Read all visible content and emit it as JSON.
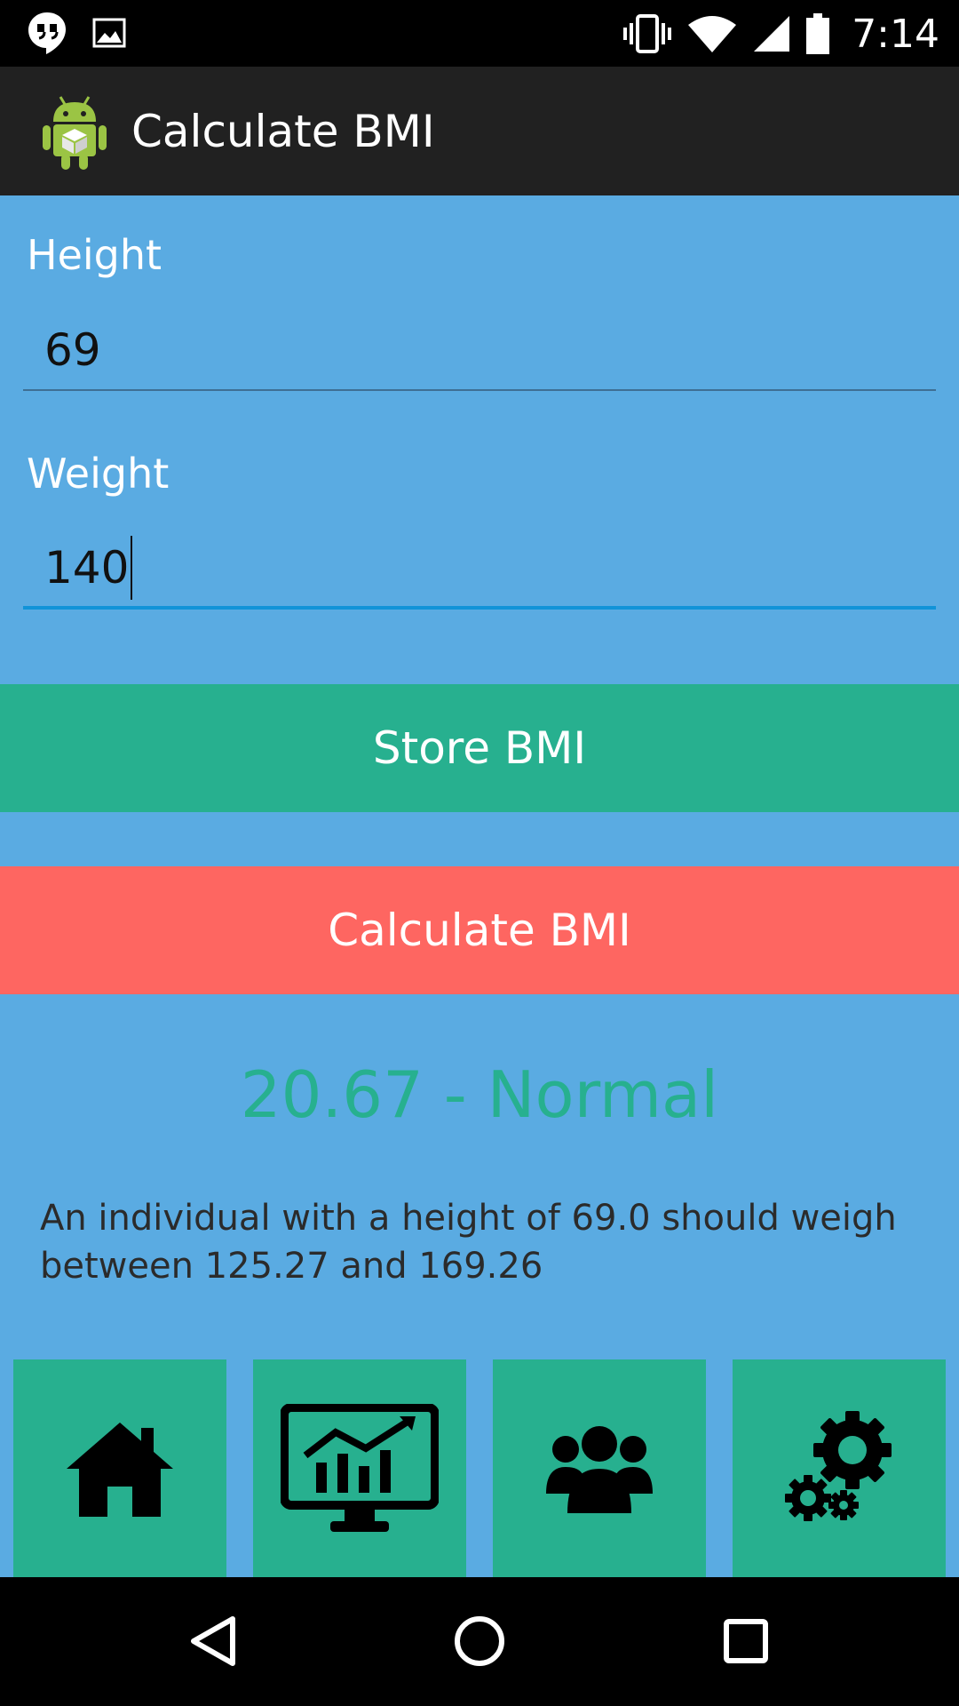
{
  "status_bar": {
    "time": "7:14",
    "icons": [
      "hangouts-icon",
      "image-notification-icon",
      "vibrate-icon",
      "wifi-icon",
      "signal-icon",
      "battery-icon"
    ]
  },
  "action_bar": {
    "title": "Calculate BMI",
    "icon": "android-app-icon"
  },
  "form": {
    "height_label": "Height",
    "height_value": "69",
    "weight_label": "Weight",
    "weight_value": "140"
  },
  "buttons": {
    "store_label": "Store BMI",
    "calculate_label": "Calculate BMI"
  },
  "result": {
    "text": "20.67 - Normal",
    "advice": "An individual with a height of 69.0 should weigh between 125.27 and 169.26"
  },
  "tiles": [
    {
      "icon": "home-icon"
    },
    {
      "icon": "chart-monitor-icon"
    },
    {
      "icon": "users-icon"
    },
    {
      "icon": "settings-gears-icon"
    }
  ],
  "nav_bar": [
    "back-icon",
    "home-circle-icon",
    "recents-icon"
  ],
  "colors": {
    "background": "#5aabe2",
    "green": "#27b08f",
    "red": "#fe6661",
    "action_bar": "#212121",
    "input_accent": "#1193d8"
  }
}
